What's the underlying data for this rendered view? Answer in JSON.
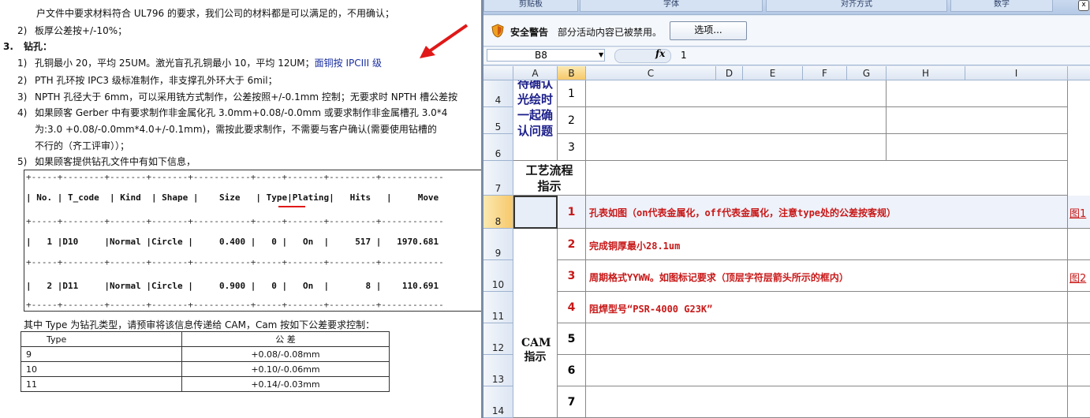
{
  "doc": {
    "line0": "户文件中要求材料符合 UL796 的要求，我们公司的材料都是可以满足的，不用确认；",
    "line1_num": "2)",
    "line1": "板厚公差按+/-10%；",
    "sec3_num": "3.",
    "sec3_title": "钻孔：",
    "items": [
      {
        "num": "1)",
        "text": "孔铜最小 20，平均 25UM。激光盲孔孔铜最小 10，平均 12UM；",
        "blue": "面铜按 IPCIII 级"
      },
      {
        "num": "2)",
        "text": "PTH 孔环按 IPC3 级标准制作，非支撑孔外环大于 6mil；",
        "blue": ""
      },
      {
        "num": "3)",
        "text": "NPTH 孔径大于 6mm，可以采用铣方式制作，公差按照+/-0.1mm 控制；无要求时 NPTH 槽公差按",
        "blue": ""
      },
      {
        "num": "4)",
        "text": "如果顾客 Gerber 中有要求制作非金属化孔 3.0mm+0.08/-0.0mm 或要求制作非金属槽孔 3.0*4",
        "blue": ""
      }
    ],
    "item4_cont1": "为:3.0 +0.08/-0.0mm*4.0+/-0.1mm)，需按此要求制作，不需要与客户确认(需要使用钻槽的",
    "item4_cont2": "不行的（齐工评审））；",
    "item5_num": "5)",
    "item5": "如果顾客提供钻孔文件中有如下信息，",
    "drill": {
      "header": "| No. | T_code  | Kind  | Shape |    Size   | Type|Plating|   Hits   |     Move",
      "row1": "|   1 |D10     |Normal |Circle |     0.400 |   0 |   On  |     517 |   1970.681",
      "row2": "|   2 |D11     |Normal |Circle |     0.900 |   0 |   On  |       8 |    110.691",
      "dash": "+-----+--------+-------+-------+-----------+-----+-------+---------+------------"
    },
    "type_note": "其中 Type 为钻孔类型，请预审将该信息传递给 CAM，Cam 按如下公差要求控制：",
    "tol_header": [
      "Type",
      "公      差"
    ],
    "tol_rows": [
      [
        "9",
        "+0.08/-0.08mm"
      ],
      [
        "10",
        "+0.10/-0.06mm"
      ],
      [
        "11",
        "+0.14/-0.03mm"
      ]
    ]
  },
  "excel": {
    "ribbon_groups": [
      "剪贴板",
      "字体",
      "对齐方式",
      "数字"
    ],
    "close_label": "x",
    "security_title": "安全警告",
    "security_msg": "部分活动内容已被禁用。",
    "options_button": "选项...",
    "name_box": "B8",
    "fx_label": "fx",
    "formula_value": "1",
    "columns": [
      "A",
      "B",
      "C",
      "D",
      "E",
      "F",
      "G",
      "H",
      "I"
    ],
    "rows": [
      "4",
      "5",
      "6",
      "7",
      "8",
      "9",
      "10",
      "11",
      "12",
      "13",
      "14"
    ],
    "label_pending": "待确认光绘时一起确认问题",
    "pending_nums": [
      "1",
      "2",
      "3"
    ],
    "label_process": "工艺流程指示",
    "label_cam": "CAM指示",
    "cam_nums": [
      "1",
      "2",
      "3",
      "4",
      "5",
      "6",
      "7"
    ],
    "cam_texts": [
      "孔表如图（on代表金属化，off代表金属化，注意type处的公差按客规）",
      "完成铜厚最小28.1um",
      "周期格式YYWW。如图标记要求（顶层字符层箭头所示的框内）",
      "阻焊型号“PSR-4000 G23K”"
    ],
    "fig1": "图1",
    "fig2": "图2"
  },
  "colors": {
    "accent_red": "#c81818",
    "navy": "#1c1f8a",
    "excel_blue": "#dfe7f3"
  }
}
